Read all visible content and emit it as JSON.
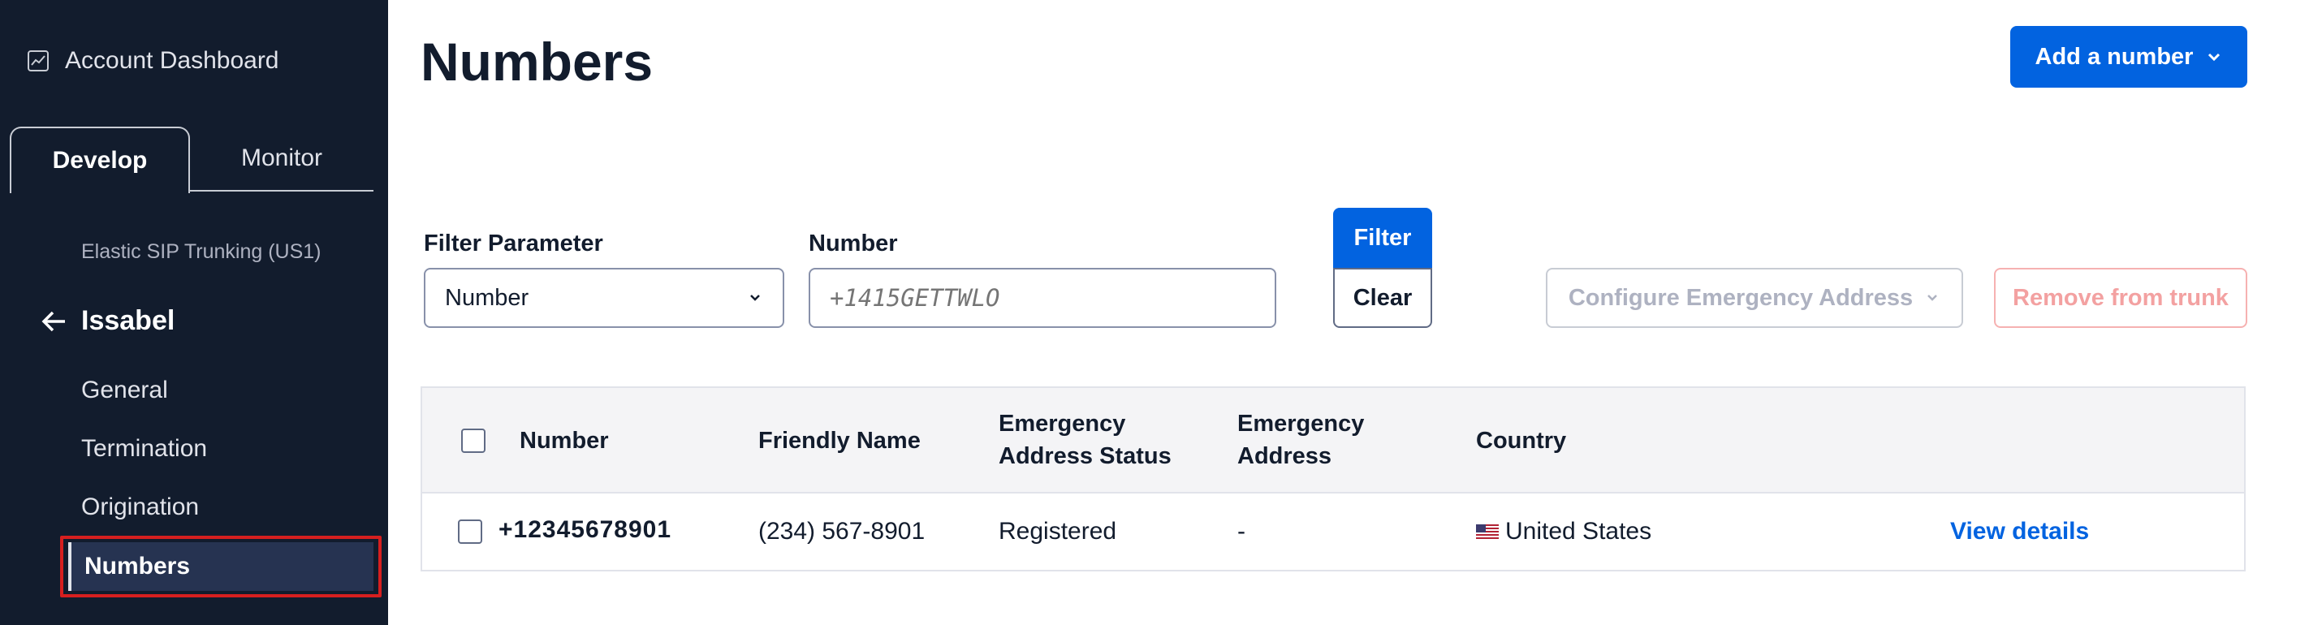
{
  "sidebar": {
    "account_dashboard": "Account Dashboard",
    "tabs": [
      {
        "label": "Develop",
        "active": true
      },
      {
        "label": "Monitor",
        "active": false
      }
    ],
    "service": "Elastic SIP Trunking (US1)",
    "back_label": "Issabel",
    "items": [
      "General",
      "Termination",
      "Origination"
    ],
    "selected_item": "Numbers"
  },
  "header": {
    "title": "Numbers",
    "add_button": "Add a number"
  },
  "filters": {
    "param_label": "Filter Parameter",
    "param_value": "Number",
    "number_label": "Number",
    "number_placeholder": "+1415GETTWLO",
    "filter_button": "Filter",
    "clear_button": "Clear",
    "configure_button": "Configure Emergency Address",
    "remove_button": "Remove from trunk"
  },
  "table": {
    "headers": {
      "number": "Number",
      "friendly_name": "Friendly Name",
      "eas_line1": "Emergency",
      "eas_line2": "Address Status",
      "ea_line1": "Emergency",
      "ea_line2": "Address",
      "country": "Country"
    },
    "rows": [
      {
        "number": "+12345678901",
        "friendly_name": "(234) 567-8901",
        "status": "Registered",
        "address": "-",
        "country": "United States",
        "action": "View details"
      }
    ]
  },
  "colors": {
    "sidebar_bg": "#121c2d",
    "primary": "#0263e0",
    "selected_outline": "#d61f1f"
  }
}
